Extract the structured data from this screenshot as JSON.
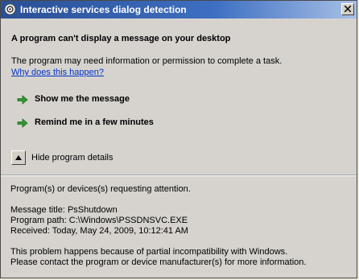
{
  "window": {
    "title": "Interactive services dialog detection",
    "close_icon": "close-icon"
  },
  "main": {
    "heading": "A program can't display a message on your desktop",
    "description": "The program may need information or permission to complete a task.",
    "why_link": "Why does this happen?",
    "commands": [
      {
        "label": "Show me the message",
        "icon": "green-arrow-icon"
      },
      {
        "label": "Remind me in a few minutes",
        "icon": "green-arrow-icon"
      }
    ],
    "details_toggle": "Hide program details"
  },
  "details": {
    "requesting": "Program(s) or devices(s) requesting attention.",
    "message_title_label": "Message title:",
    "message_title": "PsShutdown",
    "program_path_label": "Program path:",
    "program_path": "C:\\Windows\\PSSDNSVC.EXE",
    "received_label": "Received:",
    "received": "Today, May 24, 2009, 10:12:41 AM",
    "problem_line1": "This problem happens because of partial incompatibility with Windows.",
    "problem_line2": "Please contact the program or device manufacturer(s) for more information."
  },
  "colors": {
    "titlebar_start": "#2a4f94",
    "titlebar_end": "#a8c0e6",
    "link": "#0033cc",
    "arrow": "#2e9a2e"
  }
}
